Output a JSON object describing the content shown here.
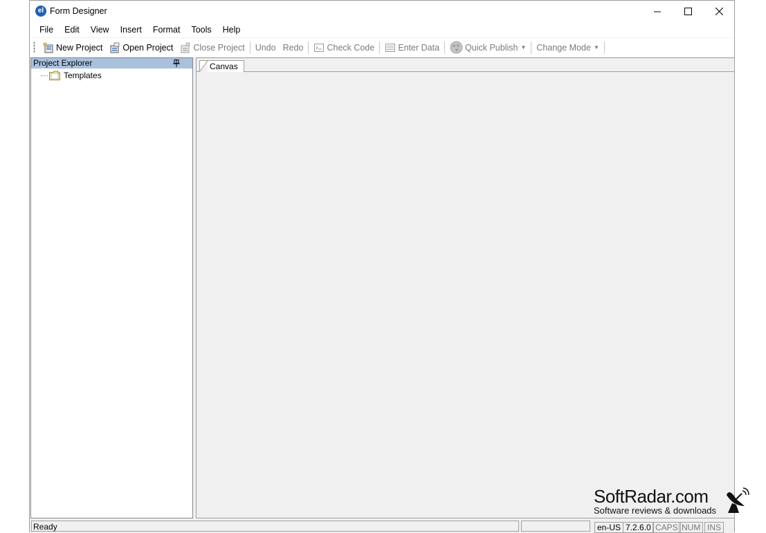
{
  "window": {
    "title": "Form Designer",
    "app_icon_text": "el",
    "controls": [
      "minimize-icon",
      "maximize-icon",
      "close-icon"
    ]
  },
  "menu": {
    "items": [
      "File",
      "Edit",
      "View",
      "Insert",
      "Format",
      "Tools",
      "Help"
    ]
  },
  "toolbar": {
    "new_project": "New Project",
    "open_project": "Open Project",
    "close_project": "Close Project",
    "undo": "Undo",
    "redo": "Redo",
    "check_code": "Check Code",
    "enter_data": "Enter Data",
    "quick_publish": "Quick Publish",
    "change_mode": "Change Mode"
  },
  "explorer": {
    "title": "Project Explorer",
    "tree": [
      {
        "label": "Templates",
        "icon": "folder-icon"
      }
    ]
  },
  "canvas": {
    "tab_label": "Canvas"
  },
  "status": {
    "message": "Ready",
    "locale": "en-US",
    "version": "7.2.6.0",
    "caps": "CAPS",
    "num": "NUM",
    "ins": "INS"
  },
  "watermark": {
    "title": "SoftRadar.com",
    "subtitle": "Software reviews & downloads"
  },
  "colors": {
    "explorer_header": "#a9c1dd",
    "app_icon": "#1f5fb5",
    "disabled_text": "#7a7a7a"
  }
}
